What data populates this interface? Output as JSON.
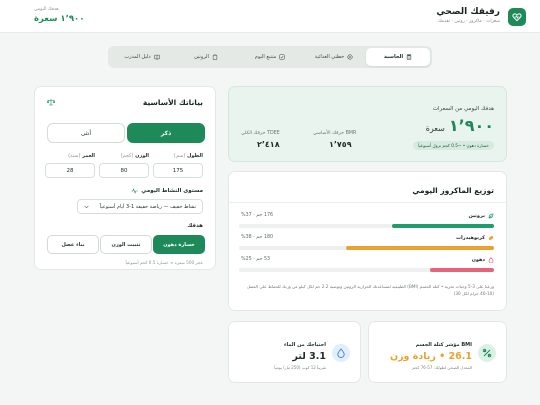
{
  "header": {
    "app_title": "رفيقك الصحي",
    "app_subtitle": "سعرات · ماكروز · روتين · تقدمك",
    "goal_label": "هدفك اليومي",
    "goal_value": "١٬٩٠٠ سعرة"
  },
  "tabs": [
    {
      "label": "دليل المدرب",
      "icon": "book-icon",
      "active": false
    },
    {
      "label": "الروتين",
      "icon": "clipboard-icon",
      "active": false
    },
    {
      "label": "متتبع اليوم",
      "icon": "checklist-icon",
      "active": false
    },
    {
      "label": "خطتي الغذائية",
      "icon": "plate-icon",
      "active": false
    },
    {
      "label": "الحاسبة",
      "icon": "calculator-icon",
      "active": true
    }
  ],
  "basics": {
    "title": "بياناتك الأساسية",
    "male": "ذكر",
    "female": "أنثى",
    "selected_gender": "ذكر",
    "height_label": "الطول",
    "height_unit": "(سم)",
    "height_value": "175",
    "weight_label": "الوزن",
    "weight_unit": "(كجم)",
    "weight_value": "80",
    "age_label": "العمر",
    "age_unit": "(سنة)",
    "age_value": "28",
    "activity_label": "مستوى النشاط اليومي",
    "activity_value": "نشاط خفيف — رياضة خفيفة 1-3 أيام أسبوعياً",
    "goal_label": "هدفك",
    "goal_options": [
      "بناء عضل",
      "تثبيت الوزن",
      "خسارة دهون"
    ],
    "selected_goal": "خسارة دهون",
    "goal_note": "عجز 500 سعرة ≈ خسارة 0.5 كجم أسبوعياً"
  },
  "target": {
    "label": "هدفك اليومي من السعرات",
    "value": "١٬٩٠٠",
    "unit": "سعرة",
    "badge": "خسارة دهون • ~0.5 كجم نزول أسبوعياً",
    "tdee_label": "TDEE حرقك الكلي",
    "tdee_value": "٢٬٤١٨",
    "bmr_label": "BMR حرقك الأساسي",
    "bmr_value": "١٬٧٥٩"
  },
  "macros": {
    "title": "توزيع الماكروز اليومي",
    "items": [
      {
        "name": "بروتين",
        "value_text": "176 جم · 37%",
        "percent": 37,
        "color": "#1e9e6a",
        "icon": "leaf-icon"
      },
      {
        "name": "كربوهيدرات",
        "value_text": "180 جم · 38%",
        "percent": 38,
        "color": "#e9a22e",
        "icon": "grain-icon"
      },
      {
        "name": "دهون",
        "value_text": "53 جم · 25%",
        "percent": 25,
        "color": "#e8637a",
        "icon": "drop-icon"
      }
    ],
    "note": "وزعنا على 3-5 وجبات بحرية • كتلة الجسم (BMI) الطبيعية لمساعدتك الحرارية الروتين وتوصية 2.2 جم لكل كيلو من وزنك للحفاظ على العضل (10-40 جرام لكل 30)"
  },
  "bmi": {
    "label": "BMI مؤشر كتلة الجسم",
    "value": "26.1 • زيادة وزن",
    "note": "المعدل الصحي لطولك: 57-76 كجم",
    "color": "#e9a22e",
    "icon": "bmi-icon"
  },
  "water": {
    "label": "احتياجك من الماء",
    "value": "3.1 لتر",
    "note": "تقريباً 12 كوب (250 مل) يومياً",
    "color": "#1f2d27",
    "icon": "water-drop-icon"
  }
}
